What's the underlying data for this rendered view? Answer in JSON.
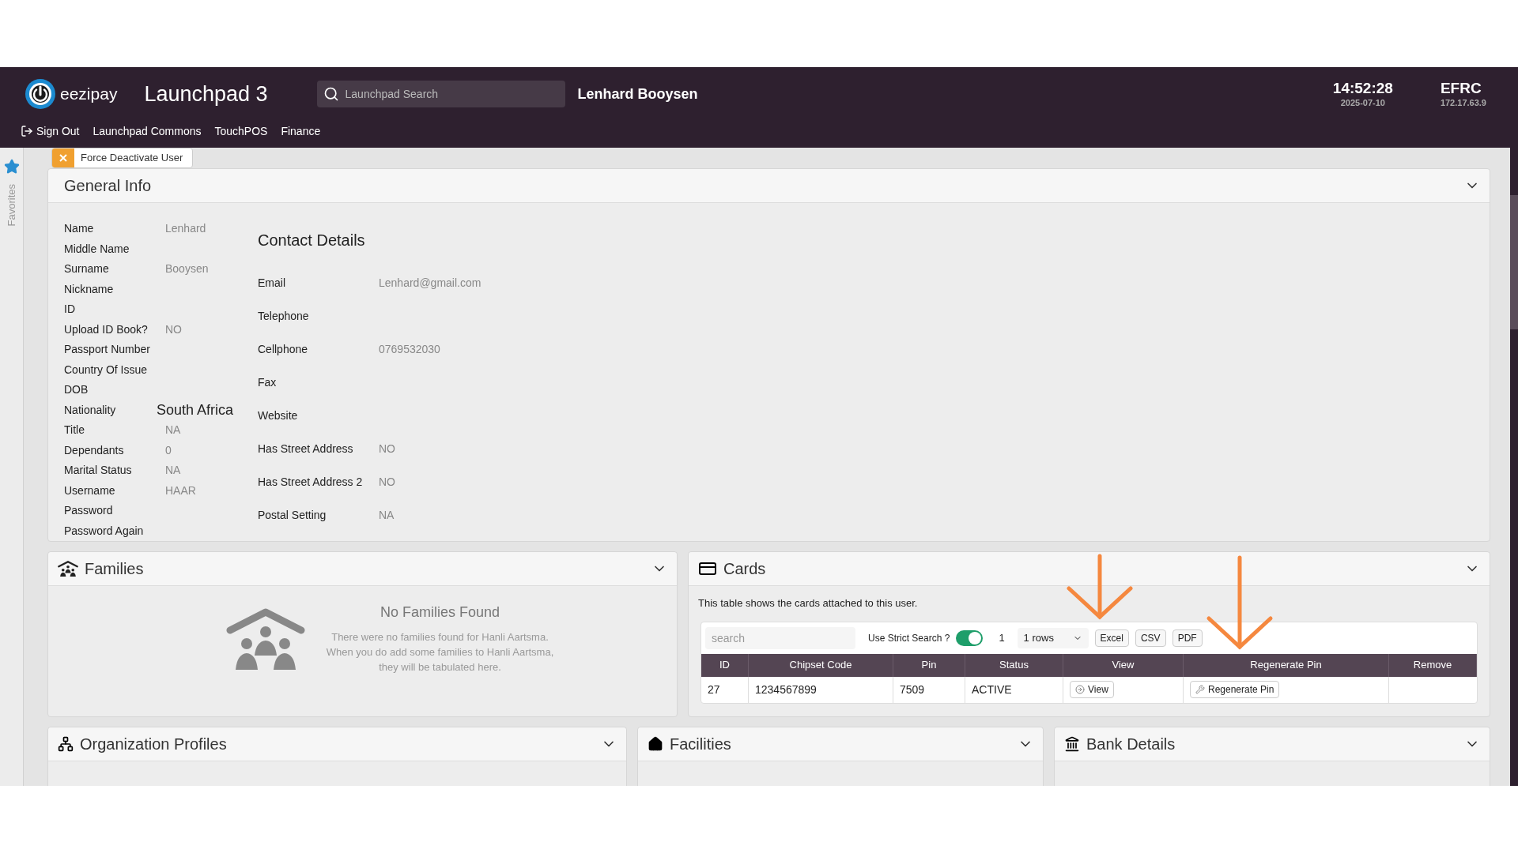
{
  "header": {
    "logo_text": "eezipay",
    "app_title": "Launchpad 3",
    "search": {
      "placeholder": "Launchpad Search"
    },
    "user_name": "Lenhard Booysen",
    "time": "14:52:28",
    "date": "2025-07-10",
    "site": "EFRC",
    "ip": "172.17.63.9"
  },
  "nav": [
    {
      "label": "Sign Out",
      "kind": "signout"
    },
    {
      "label": "Launchpad Commons",
      "kind": "link"
    },
    {
      "label": "TouchPOS",
      "kind": "link"
    },
    {
      "label": "Finance",
      "kind": "link"
    }
  ],
  "sidebar": {
    "label": "Favorites"
  },
  "force_button": {
    "label": "Force Deactivate User"
  },
  "general_info": {
    "title": "General Info",
    "personal": [
      {
        "label": "Name",
        "value": "Lenhard",
        "large": false
      },
      {
        "label": "Middle Name"
      },
      {
        "label": "Surname",
        "value": "Booysen",
        "large": false
      },
      {
        "label": "Nickname"
      },
      {
        "label": "ID"
      },
      {
        "label": "Upload ID Book?",
        "value": "NO",
        "large": false
      },
      {
        "label": "Passport Number"
      },
      {
        "label": "Country Of Issue"
      },
      {
        "label": "DOB"
      },
      {
        "label": "Nationality",
        "value": "South Africa",
        "large": true
      },
      {
        "label": "Title",
        "value": "NA",
        "large": false
      },
      {
        "label": "Dependants",
        "value": "0",
        "large": false
      },
      {
        "label": "Marital Status",
        "value": "NA",
        "large": false
      },
      {
        "label": "Username",
        "value": "HAAR",
        "large": false
      },
      {
        "label": "Password"
      },
      {
        "label": "Password Again"
      }
    ],
    "contact": {
      "title": "Contact Details",
      "fields": [
        {
          "label": "Email",
          "value": "Lenhard@gmail.com"
        },
        {
          "label": "Telephone"
        },
        {
          "label": "Cellphone",
          "value": "0769532030"
        },
        {
          "label": "Fax"
        },
        {
          "label": "Website"
        },
        {
          "label": "Has Street Address",
          "value": "NO"
        },
        {
          "label": "Has Street Address 2",
          "value": "NO"
        },
        {
          "label": "Postal Setting",
          "value": "NA"
        }
      ]
    }
  },
  "families": {
    "title": "Families",
    "empty_title": "No Families Found",
    "empty_message": "There were no families found for Hanli Aartsma. When you do add some families to Hanli Aartsma, they will be tabulated here."
  },
  "cards": {
    "title": "Cards",
    "description": "This table shows the cards attached to this user.",
    "search": {
      "placeholder": "search"
    },
    "strict_search": {
      "label": "Use Strict Search ?",
      "on": true
    },
    "count": "1",
    "rows_select": "1 rows",
    "exports": [
      "Excel",
      "CSV",
      "PDF"
    ],
    "columns": [
      "ID",
      "Chipset Code",
      "Pin",
      "Status",
      "View",
      "Regenerate Pin",
      "Remove"
    ],
    "rows": [
      {
        "cells": [
          "27",
          "1234567899",
          "7509",
          "ACTIVE"
        ],
        "view": "View",
        "regenerate": "Regenerate Pin"
      }
    ],
    "annotations": [
      {
        "kind": "arrow"
      },
      {
        "kind": "arrow"
      }
    ]
  },
  "bottom_panels": [
    {
      "title": "Organization Profiles",
      "kind": "org"
    },
    {
      "title": "Facilities",
      "kind": "home"
    },
    {
      "title": "Bank Details",
      "kind": "bank"
    }
  ]
}
